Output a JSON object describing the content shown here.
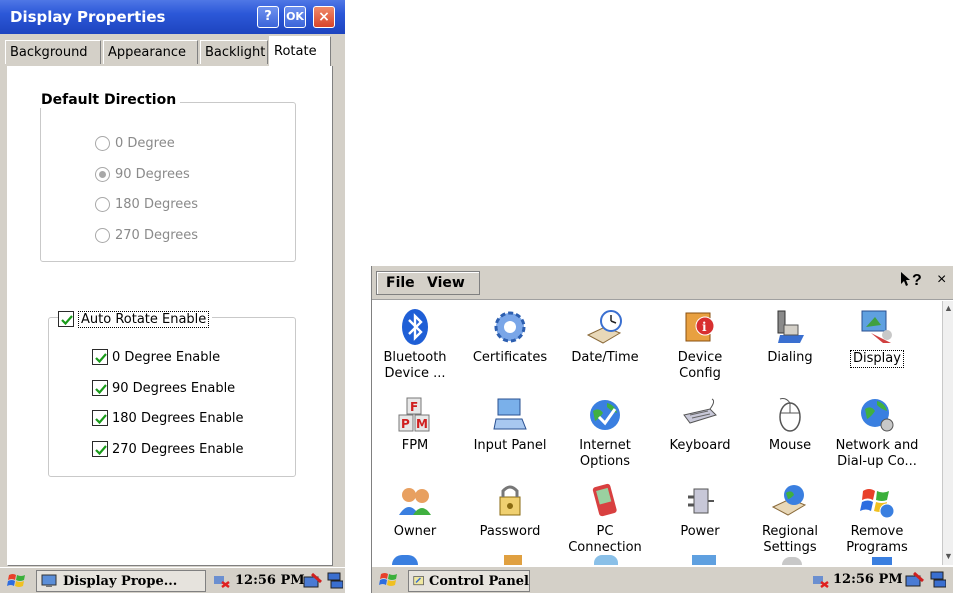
{
  "left_window": {
    "title": "Display Properties",
    "title_buttons": {
      "help": "?",
      "ok": "OK",
      "close": "×"
    },
    "tabs": [
      "Background",
      "Appearance",
      "Backlight",
      "Rotate"
    ],
    "active_tab": "Rotate",
    "default_direction": {
      "label": "Default Direction",
      "options": [
        "0 Degree",
        "90 Degrees",
        "180 Degrees",
        "270 Degrees"
      ],
      "selected": "90 Degrees"
    },
    "auto_rotate": {
      "label": "Auto Rotate Enable",
      "checked": true,
      "options": [
        "0 Degree Enable",
        "90 Degrees Enable",
        "180 Degrees Enable",
        "270 Degrees Enable"
      ]
    },
    "taskbar": {
      "task": "Display Prope...",
      "time": "12:56 PM"
    }
  },
  "right_window": {
    "menu": [
      "File",
      "View"
    ],
    "help_symbol": "?",
    "close_symbol": "×",
    "items": [
      {
        "label": "Bluetooth Device ...",
        "icon": "bluetooth-icon"
      },
      {
        "label": "Certificates",
        "icon": "certificates-icon"
      },
      {
        "label": "Date/Time",
        "icon": "date-time-icon"
      },
      {
        "label": "Device Config",
        "icon": "device-config-icon"
      },
      {
        "label": "Dialing",
        "icon": "dialing-icon"
      },
      {
        "label": "Display",
        "icon": "display-icon"
      },
      {
        "label": "FPM",
        "icon": "fpm-icon"
      },
      {
        "label": "Input Panel",
        "icon": "input-panel-icon"
      },
      {
        "label": "Internet Options",
        "icon": "internet-options-icon"
      },
      {
        "label": "Keyboard",
        "icon": "keyboard-icon"
      },
      {
        "label": "Mouse",
        "icon": "mouse-icon"
      },
      {
        "label": "Network and Dial-up Co...",
        "icon": "network-icon"
      },
      {
        "label": "Owner",
        "icon": "owner-icon"
      },
      {
        "label": "Password",
        "icon": "password-icon"
      },
      {
        "label": "PC Connection",
        "icon": "pc-connection-icon"
      },
      {
        "label": "Power",
        "icon": "power-icon"
      },
      {
        "label": "Regional Settings",
        "icon": "regional-settings-icon"
      },
      {
        "label": "Remove Programs",
        "icon": "remove-programs-icon"
      }
    ],
    "selected_item": "Display",
    "taskbar": {
      "task": "Control Panel",
      "time": "12:56 PM"
    }
  }
}
